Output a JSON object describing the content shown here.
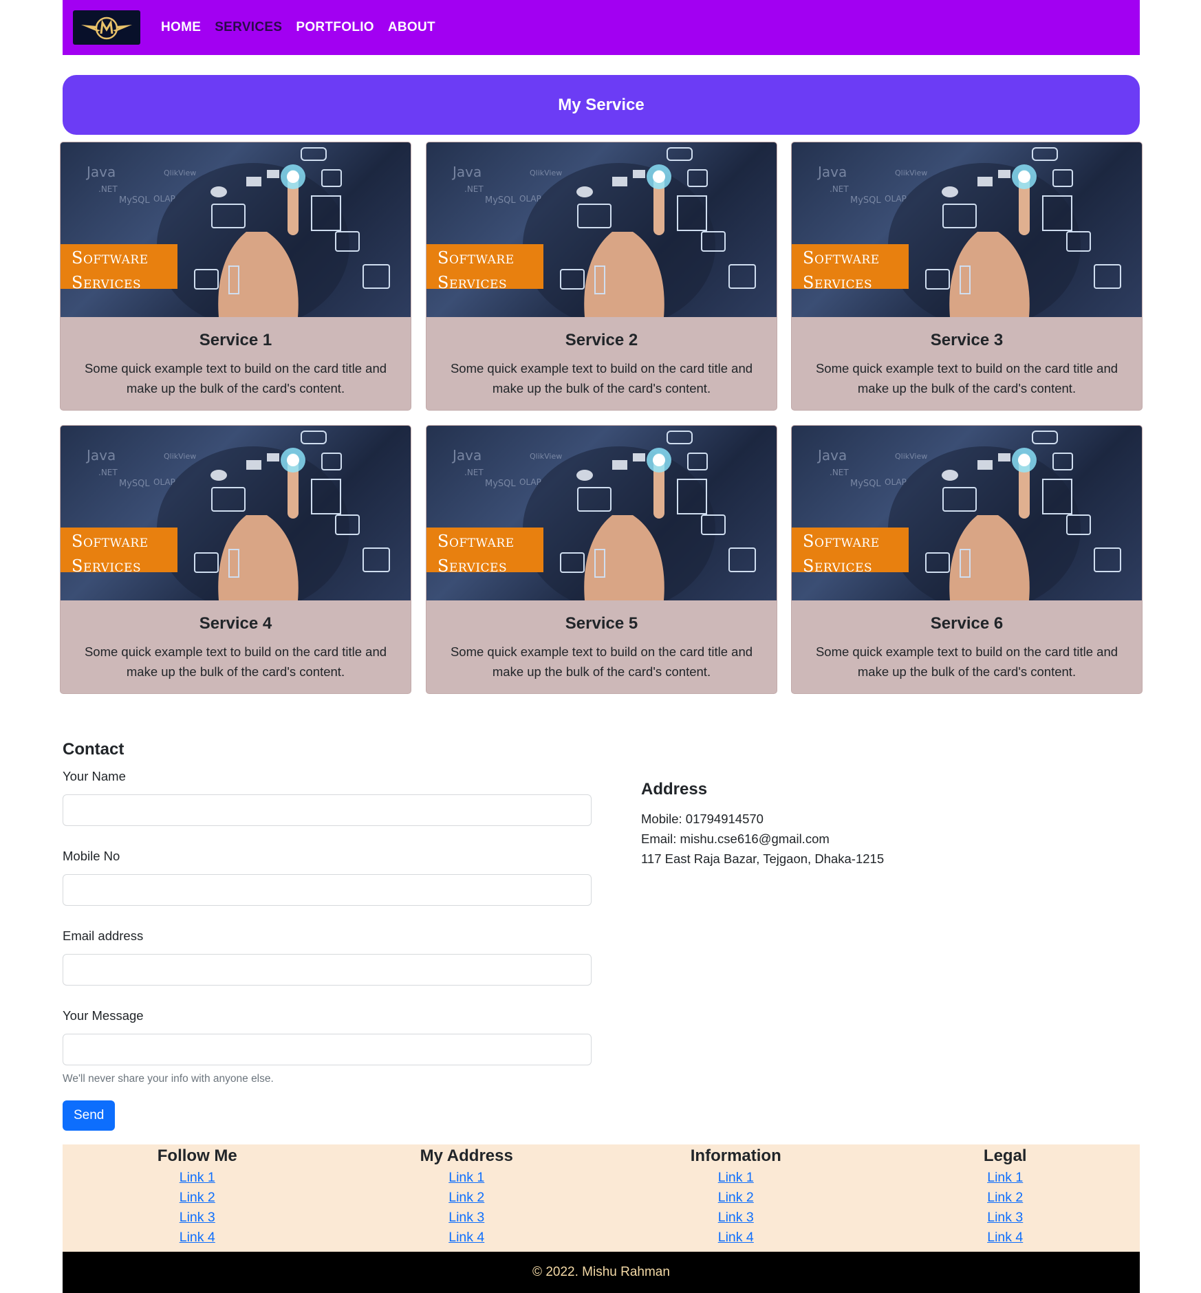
{
  "nav": {
    "logo_icon": "winged-m-logo",
    "links": [
      "HOME",
      "SERVICES",
      "PORTFOLIO",
      "ABOUT"
    ],
    "active": "SERVICES"
  },
  "banner": {
    "title": "My Service"
  },
  "cards": [
    {
      "title": "Service 1",
      "text": "Some quick example text to build on the card title and make up the bulk of the card's content.",
      "badge_line1": "Software",
      "badge_line2": "Services"
    },
    {
      "title": "Service 2",
      "text": "Some quick example text to build on the card title and make up the bulk of the card's content.",
      "badge_line1": "Software",
      "badge_line2": "Services"
    },
    {
      "title": "Service 3",
      "text": "Some quick example text to build on the card title and make up the bulk of the card's content.",
      "badge_line1": "Software",
      "badge_line2": "Services"
    },
    {
      "title": "Service 4",
      "text": "Some quick example text to build on the card title and make up the bulk of the card's content.",
      "badge_line1": "Software",
      "badge_line2": "Services"
    },
    {
      "title": "Service 5",
      "text": "Some quick example text to build on the card title and make up the bulk of the card's content.",
      "badge_line1": "Software",
      "badge_line2": "Services"
    },
    {
      "title": "Service 6",
      "text": "Some quick example text to build on the card title and make up the bulk of the card's content.",
      "badge_line1": "Software",
      "badge_line2": "Services"
    }
  ],
  "contact": {
    "heading": "Contact",
    "name_label": "Your Name",
    "mobile_label": "Mobile No",
    "email_label": "Email address",
    "message_label": "Your Message",
    "help_text": "We'll never share your info with anyone else.",
    "send_label": "Send"
  },
  "address": {
    "heading": "Address",
    "mobile_label": "Mobile:",
    "mobile_value": "01794914570",
    "email_label": "Email:",
    "email_value": "mishu.cse616@gmail.com",
    "street": "117 East Raja Bazar, Tejgaon, Dhaka-1215"
  },
  "footer": {
    "columns": [
      {
        "heading": "Follow Me",
        "links": [
          "Link 1",
          "Link 2",
          "Link 3",
          "Link 4"
        ]
      },
      {
        "heading": "My Address",
        "links": [
          "Link 1",
          "Link 2",
          "Link 3",
          "Link 4"
        ]
      },
      {
        "heading": "Information",
        "links": [
          "Link 1",
          "Link 2",
          "Link 3",
          "Link 4"
        ]
      },
      {
        "heading": "Legal",
        "links": [
          "Link 1",
          "Link 2",
          "Link 3",
          "Link 4"
        ]
      }
    ],
    "copyright": "© 2022. Mishu Rahman"
  },
  "colors": {
    "navbar": "#a200f2",
    "banner": "#6c3cf5",
    "card_body": "#cdb8b8",
    "badge": "#e8800f",
    "primary_button": "#0d6efd",
    "footer_links_bg": "#fbe9d5",
    "footer_bottom_bg": "#000000"
  }
}
